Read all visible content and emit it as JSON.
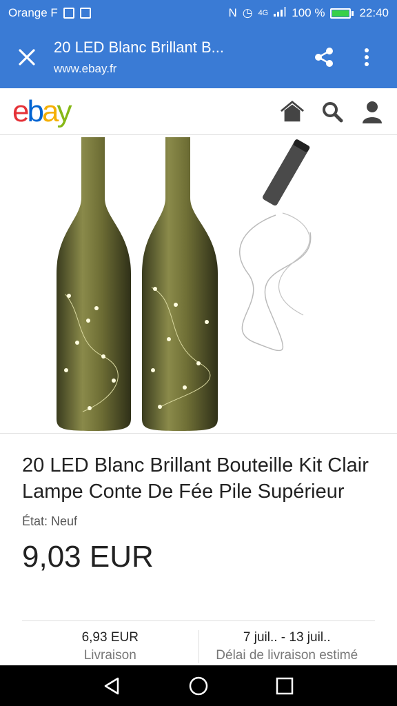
{
  "status_bar": {
    "carrier": "Orange F",
    "signal_text": "4G",
    "battery": "100 %",
    "time": "22:40"
  },
  "browser_bar": {
    "page_title": "20 LED Blanc Brillant B...",
    "url": "www.ebay.fr",
    "accent_color": "#3a7bd5"
  },
  "ebay_header": {
    "logo_letters": [
      "e",
      "b",
      "a",
      "y"
    ],
    "icons": [
      "home-icon",
      "search-icon",
      "account-icon"
    ]
  },
  "product": {
    "title": "20 LED Blanc Brillant Bouteille Kit Clair Lampe Conte De Fée Pile Supérieur",
    "condition": "État: Neuf",
    "price": "9,03 EUR"
  },
  "shipping": {
    "cost_value": "6,93 EUR",
    "cost_label": "Livraison",
    "delivery_value": "7 juil.. - 13 juil..",
    "delivery_label": "Délai de livraison estimé"
  },
  "nav": {
    "icons": [
      "back-icon",
      "home-icon",
      "recents-icon"
    ]
  }
}
